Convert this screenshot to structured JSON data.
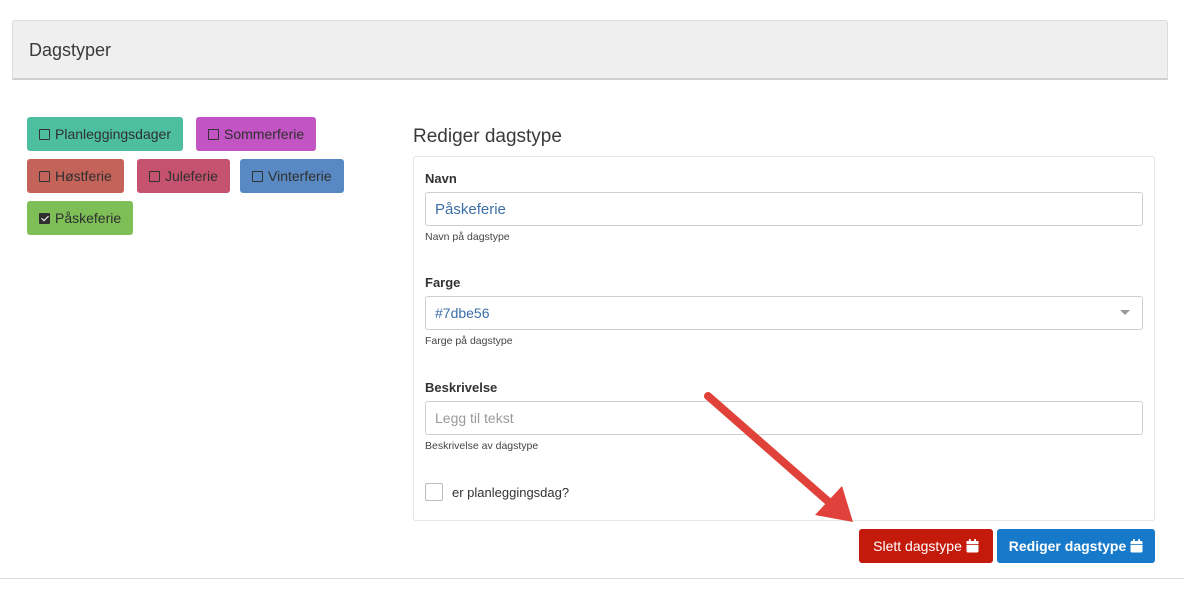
{
  "header": {
    "title": "Dagstyper"
  },
  "day_types": [
    {
      "label": "Planleggingsdager",
      "color": "#4dbfa0",
      "checked": false
    },
    {
      "label": "Sommerferie",
      "color": "#c254c4",
      "checked": false
    },
    {
      "label": "Høstferie",
      "color": "#c4635a",
      "checked": false
    },
    {
      "label": "Juleferie",
      "color": "#c5536f",
      "checked": false
    },
    {
      "label": "Vinterferie",
      "color": "#5989c2",
      "checked": false
    },
    {
      "label": "Påskeferie",
      "color": "#7dbe56",
      "checked": true
    }
  ],
  "form": {
    "title": "Rediger dagstype",
    "name": {
      "label": "Navn",
      "value": "Påskeferie",
      "help": "Navn på dagstype"
    },
    "color": {
      "label": "Farge",
      "value": "#7dbe56",
      "help": "Farge på dagstype"
    },
    "description": {
      "label": "Beskrivelse",
      "placeholder": "Legg til tekst",
      "help": "Beskrivelse av dagstype"
    },
    "planning_day": {
      "label": "er planleggingsdag?",
      "checked": false
    }
  },
  "buttons": {
    "delete_label": "Slett dagstype",
    "edit_label": "Rediger dagstype",
    "delete_color": "#c41a0c",
    "edit_color": "#1679c9"
  },
  "annotation": {
    "arrow_color": "#e0413a"
  }
}
